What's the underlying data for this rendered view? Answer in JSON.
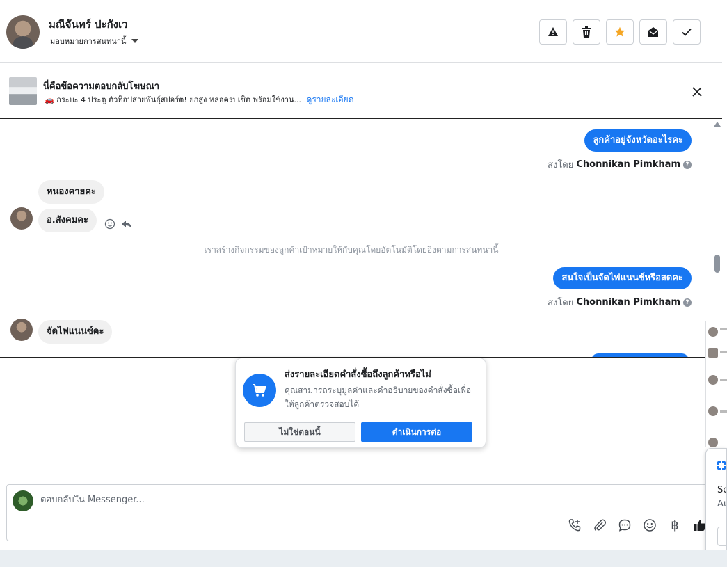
{
  "header": {
    "contact_name": "มณีจันทร์ ปะกังเว",
    "assign_label": "มอบหมายการสนทนานี้",
    "actions": [
      {
        "name": "report-button",
        "icon": "warning-icon"
      },
      {
        "name": "delete-button",
        "icon": "trash-icon"
      },
      {
        "name": "star-button",
        "icon": "star-icon"
      },
      {
        "name": "mark-unread-button",
        "icon": "envelope-open-icon"
      },
      {
        "name": "mark-done-button",
        "icon": "check-icon"
      }
    ]
  },
  "ad": {
    "title": "นี่คือข้อความตอบกลับโฆษณา",
    "description": "🚗 กระบะ 4 ประตู ตัวท็อปสายพันธุ์สปอร์ต! ยกสูง หล่อครบเซ็ต พร้อมใช้งาน...",
    "link": "ดูรายละเอียด"
  },
  "chat": {
    "messages": [
      {
        "dir": "out",
        "text": "ลูกค้าอยู่จังหวัดอะไรคะ"
      },
      {
        "dir": "in",
        "text": "หนองคายคะ"
      },
      {
        "dir": "in",
        "text": "อ.สังคมคะ"
      },
      {
        "dir": "out",
        "text": "สนใจเป็นจัดไฟแนนซ์หรือสดคะ"
      },
      {
        "dir": "in",
        "text": "จัดไฟแนนซ์คะ"
      }
    ],
    "sent_by_prefix": "ส่งโดย",
    "sender_name": "Chonnikan Pimkham",
    "system_note": "เราสร้างกิจกรรมของลูกค้าเป้าหมายให้กับคุณโดยอัตโนมัติโดยอิงตามการสนทนานี้"
  },
  "order_prompt": {
    "title": "ส่งรายละเอียดคำสั่งซื้อถึงลูกค้าหรือไม่",
    "body": "คุณสามารถระบุมูลค่าและคำอธิบายของคำสั่งซื้อเพื่อให้ลูกค้าตรวจสอบได้",
    "not_now": "ไม่ใช่ตอนนี้",
    "continue": "ดำเนินการต่อ"
  },
  "composer": {
    "placeholder": "ตอบกลับใน Messenger...",
    "baht_symbol": "฿",
    "tools": [
      "phone-add-icon",
      "attachment-icon",
      "quick-reply-icon",
      "emoji-icon",
      "baht-icon",
      "thumbs-up-icon"
    ]
  },
  "side_popup": {
    "line1": "Sc",
    "line2": "Au"
  },
  "colors": {
    "accent": "#1877f2",
    "star": "#f5a623"
  }
}
